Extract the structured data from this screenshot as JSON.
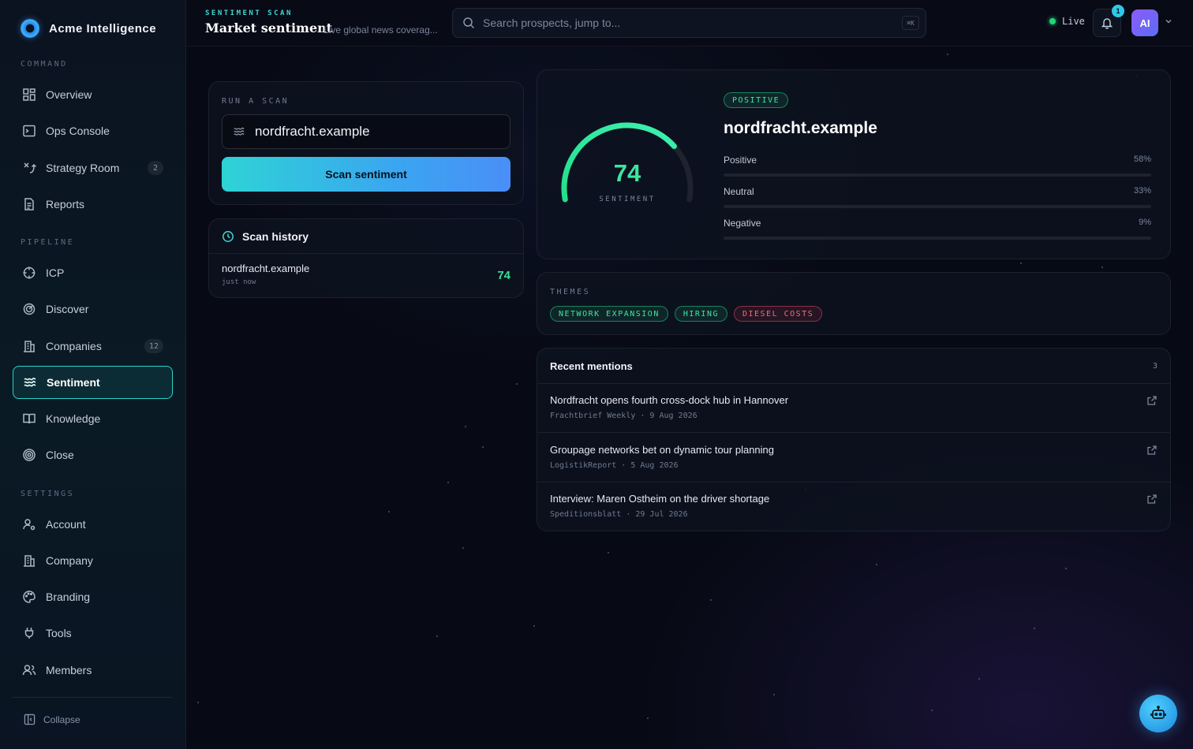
{
  "brand": {
    "name": "Acme Intelligence"
  },
  "sidebar": {
    "sections": {
      "command": "COMMAND",
      "pipeline": "PIPELINE",
      "settings": "SETTINGS"
    },
    "items": {
      "overview": {
        "label": "Overview",
        "icon": "grid-icon"
      },
      "ops_console": {
        "label": "Ops Console",
        "icon": "terminal-icon"
      },
      "strategy_room": {
        "label": "Strategy Room",
        "icon": "strategy-icon",
        "badge": "2"
      },
      "reports": {
        "label": "Reports",
        "icon": "document-icon"
      },
      "icp": {
        "label": "ICP",
        "icon": "crosshair-icon"
      },
      "discover": {
        "label": "Discover",
        "icon": "radar-icon"
      },
      "companies": {
        "label": "Companies",
        "icon": "building-icon",
        "badge": "12"
      },
      "sentiment": {
        "label": "Sentiment",
        "icon": "waves-icon",
        "active": true
      },
      "knowledge": {
        "label": "Knowledge",
        "icon": "book-icon"
      },
      "close": {
        "label": "Close",
        "icon": "target-icon"
      },
      "account": {
        "label": "Account",
        "icon": "user-cog-icon"
      },
      "company": {
        "label": "Company",
        "icon": "building-icon"
      },
      "branding": {
        "label": "Branding",
        "icon": "palette-icon"
      },
      "tools": {
        "label": "Tools",
        "icon": "plug-icon"
      },
      "members": {
        "label": "Members",
        "icon": "users-icon"
      }
    },
    "collapse_label": "Collapse"
  },
  "header": {
    "eyebrow": "SENTIMENT SCAN",
    "title": "Market sentiment",
    "subtitle": "Live global news coverag...",
    "search_placeholder": "Search prospects, jump to...",
    "search_shortcut": "⌘K",
    "live_label": "Live",
    "notification_count": "1",
    "avatar_initials": "AI"
  },
  "scan": {
    "label": "RUN A SCAN",
    "input_value": "nordfracht.example",
    "button_label": "Scan sentiment"
  },
  "history": {
    "title": "Scan history",
    "items": [
      {
        "domain": "nordfracht.example",
        "time": "just now",
        "score": "74"
      }
    ]
  },
  "result": {
    "badge": "POSITIVE",
    "domain": "nordfracht.example",
    "score": "74",
    "score_label": "SENTIMENT",
    "gauge_fraction": 0.74,
    "breakdown": [
      {
        "label": "Positive",
        "pct_label": "58%",
        "value": 58,
        "color": "#2fe39a"
      },
      {
        "label": "Neutral",
        "pct_label": "33%",
        "value": 33,
        "color": "#7b859b"
      },
      {
        "label": "Negative",
        "pct_label": "9%",
        "value": 9,
        "color": "#f06b7e"
      }
    ]
  },
  "themes": {
    "label": "THEMES",
    "items": [
      {
        "label": "NETWORK EXPANSION",
        "tone": "positive"
      },
      {
        "label": "HIRING",
        "tone": "positive"
      },
      {
        "label": "DIESEL COSTS",
        "tone": "negative"
      }
    ]
  },
  "mentions": {
    "title": "Recent mentions",
    "count": "3",
    "items": [
      {
        "title": "Nordfracht opens fourth cross-dock hub in Hannover",
        "meta": "Frachtbrief Weekly · 9 Aug 2026"
      },
      {
        "title": "Groupage networks bet on dynamic tour planning",
        "meta": "LogistikReport · 5 Aug 2026"
      },
      {
        "title": "Interview: Maren Ostheim on the driver shortage",
        "meta": "Speditionsblatt · 29 Jul 2026"
      }
    ]
  },
  "colors": {
    "accent": "#2bd4c8",
    "positive": "#3ee69c",
    "negative": "#f06b7e",
    "live": "#22d47a"
  }
}
